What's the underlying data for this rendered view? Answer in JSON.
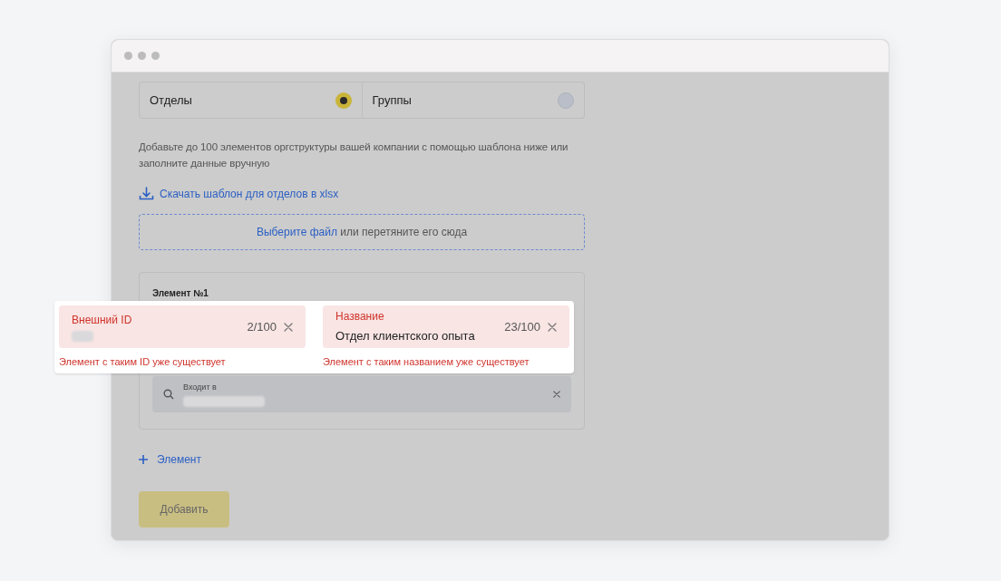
{
  "tabs": [
    {
      "label": "Отделы",
      "selected": true
    },
    {
      "label": "Группы",
      "selected": false
    }
  ],
  "description": "Добавьте до 100 элементов оргструктуры вашей компании с помощью шаблона ниже или заполните данные вручную",
  "template_link": "Скачать шаблон для отделов в xlsx",
  "dropzone": {
    "link": "Выберите файл",
    "text": "или перетяните его сюда"
  },
  "element": {
    "title": "Элемент №1",
    "parent_field": {
      "label": "Входит в",
      "value_hidden": true
    }
  },
  "error_fields": [
    {
      "label": "Внешний ID",
      "counter": "2/100",
      "value_hidden": true,
      "error": "Элемент с таким ID уже существует"
    },
    {
      "label": "Название",
      "counter": "23/100",
      "value": "Отдел клиентского опыта",
      "value_hidden": false,
      "error": "Элемент с таким названием уже существует"
    }
  ],
  "add_element": "Элемент",
  "submit": "Добавить"
}
